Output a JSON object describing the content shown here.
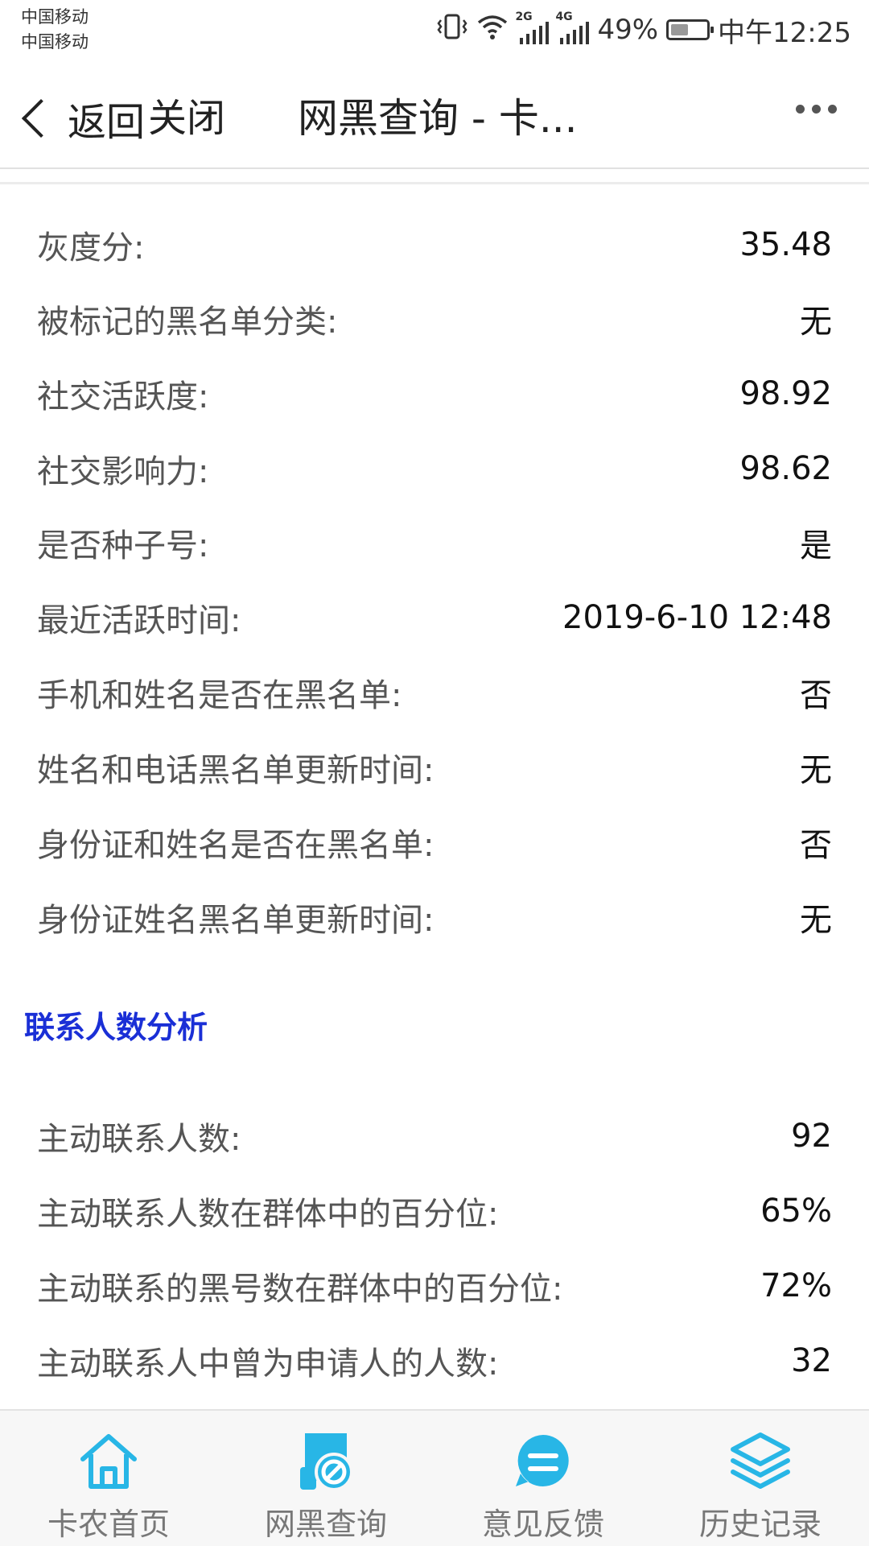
{
  "status_bar": {
    "carrier1": "中国移动",
    "carrier2": "中国移动",
    "net1": "2G",
    "net2": "4G",
    "battery": "49%",
    "battery_level": 0.49,
    "time": "中午12:25"
  },
  "nav": {
    "back_label": "返回",
    "close_label": "关闭",
    "title": "网黑查询 - 卡..."
  },
  "rows1": [
    {
      "label": "灰度分:",
      "value": "35.48"
    },
    {
      "label": "被标记的黑名单分类:",
      "value": "无"
    },
    {
      "label": "社交活跃度:",
      "value": "98.92"
    },
    {
      "label": "社交影响力:",
      "value": "98.62"
    },
    {
      "label": "是否种子号:",
      "value": "是"
    },
    {
      "label": "最近活跃时间:",
      "value": "2019-6-10 12:48"
    },
    {
      "label": "手机和姓名是否在黑名单:",
      "value": "否"
    },
    {
      "label": "姓名和电话黑名单更新时间:",
      "value": "无"
    },
    {
      "label": "身份证和姓名是否在黑名单:",
      "value": "否"
    },
    {
      "label": "身份证姓名黑名单更新时间:",
      "value": "无"
    }
  ],
  "section": {
    "title": "联系人数分析",
    "accent_color": "#1a2fd6"
  },
  "rows2": [
    {
      "label": "主动联系人数:",
      "value": "92"
    },
    {
      "label": "主动联系人数在群体中的百分位:",
      "value": "65%"
    },
    {
      "label": "主动联系的黑号数在群体中的百分位:",
      "value": "72%"
    },
    {
      "label": "主动联系人中曾为申请人的人数:",
      "value": "32"
    }
  ],
  "tabs": [
    {
      "label": "卡农首页",
      "icon": "home-icon"
    },
    {
      "label": "网黑查询",
      "icon": "blacklist-query-icon"
    },
    {
      "label": "意见反馈",
      "icon": "feedback-icon"
    },
    {
      "label": "历史记录",
      "icon": "layers-icon"
    }
  ],
  "colors": {
    "tab_icon": "#28b6e6"
  }
}
